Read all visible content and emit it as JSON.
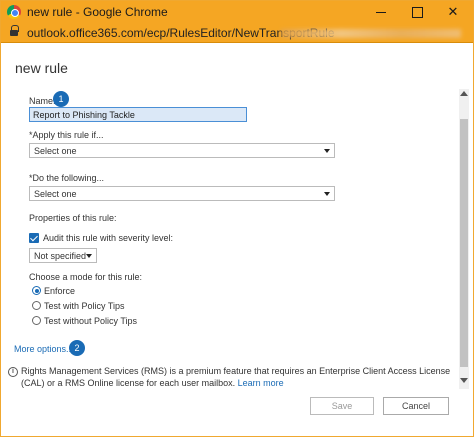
{
  "window": {
    "title": "new rule - Google Chrome",
    "url": "outlook.office365.com/ecp/RulesEditor/NewTransportRule"
  },
  "dialog": {
    "title": "new rule",
    "name_label": "Name:",
    "name_value": "Report to Phishing Tackle",
    "badge_1": "1",
    "apply_label": "*Apply this rule if...",
    "apply_value": "Select one",
    "do_label": "*Do the following...",
    "do_value": "Select one",
    "properties_label": "Properties of this rule:",
    "audit_label": "Audit this rule with severity level:",
    "audit_checked": true,
    "severity_value": "Not specified",
    "mode_label": "Choose a mode for this rule:",
    "modes": [
      {
        "label": "Enforce",
        "checked": true
      },
      {
        "label": "Test with Policy Tips",
        "checked": false
      },
      {
        "label": "Test without Policy Tips",
        "checked": false
      }
    ],
    "more_options": "More options...",
    "badge_2": "2",
    "rms_text": "Rights Management Services (RMS) is a premium feature that requires an Enterprise Client Access License (CAL) or a RMS Online license for each user mailbox.",
    "learn_more": "Learn more",
    "save_label": "Save",
    "cancel_label": "Cancel"
  },
  "colors": {
    "titlebar": "#f5a623",
    "accent": "#1a6bb5",
    "input_bg": "#dbe8f7"
  }
}
